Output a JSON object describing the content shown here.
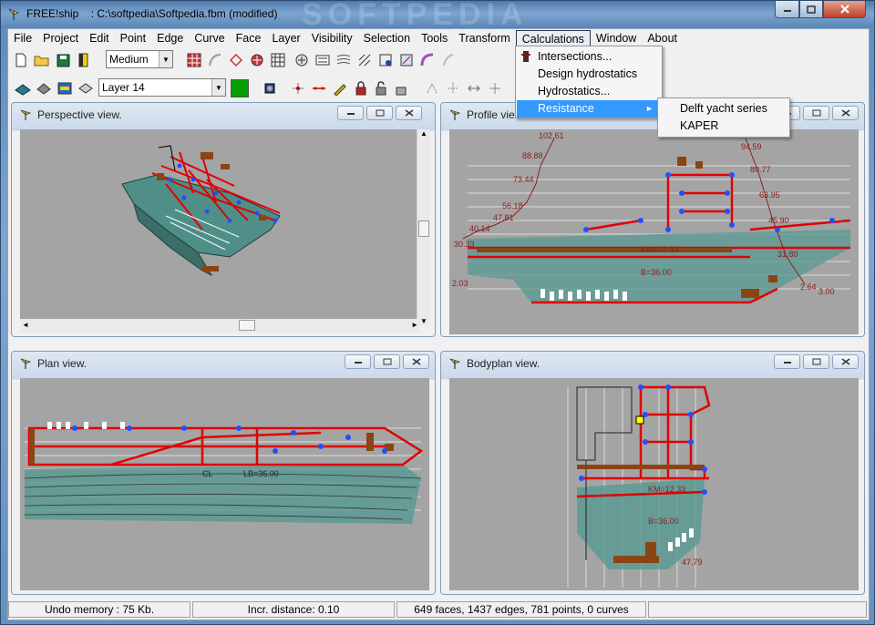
{
  "window": {
    "title": "FREE!ship    : C:\\softpedia\\Softpedia.fbm (modified)",
    "watermark": "SOFTPEDIA"
  },
  "menubar": [
    "File",
    "Project",
    "Edit",
    "Point",
    "Edge",
    "Curve",
    "Face",
    "Layer",
    "Visibility",
    "Selection",
    "Tools",
    "Transform",
    "Calculations",
    "Window",
    "About"
  ],
  "toolbar": {
    "precision_value": "Medium",
    "layer_value": "Layer 14",
    "layer_color": "#00a000"
  },
  "calculations_menu": {
    "items": [
      "Intersections...",
      "Design hydrostatics",
      "Hydrostatics...",
      "Resistance"
    ],
    "selected": "Resistance"
  },
  "resistance_submenu": [
    "Delft yacht series",
    "KAPER"
  ],
  "views": {
    "perspective": "Perspective view.",
    "profile": "Profile view.",
    "plan": "Plan view.",
    "bodyplan": "Bodyplan view."
  },
  "profile_labels": [
    "102.61",
    "88.88",
    "73.44",
    "56.18",
    "47.81",
    "40.14",
    "30.33",
    "94.59",
    "80.77",
    "63.95",
    "45.90",
    "31.80",
    "2.64",
    "3.00",
    "KM=12.33",
    "B=36.00",
    "2.03"
  ],
  "plan_labels": [
    "CL",
    "LB=36.00"
  ],
  "body_labels": [
    "KM=12.33",
    "B=36.00",
    "47.79"
  ],
  "statusbar": {
    "undo": "Undo memory : 75 Kb.",
    "incr": "Incr. distance: 0.10",
    "stats": "649 faces, 1437 edges, 781 points, 0 curves"
  },
  "colors": {
    "hull": "#4f8f88",
    "edges": "#e00000",
    "points": "#2050ff",
    "deck": "#8b4513",
    "viewport_bg": "#a4a4a4",
    "menu_highlight": "#3399ff"
  }
}
